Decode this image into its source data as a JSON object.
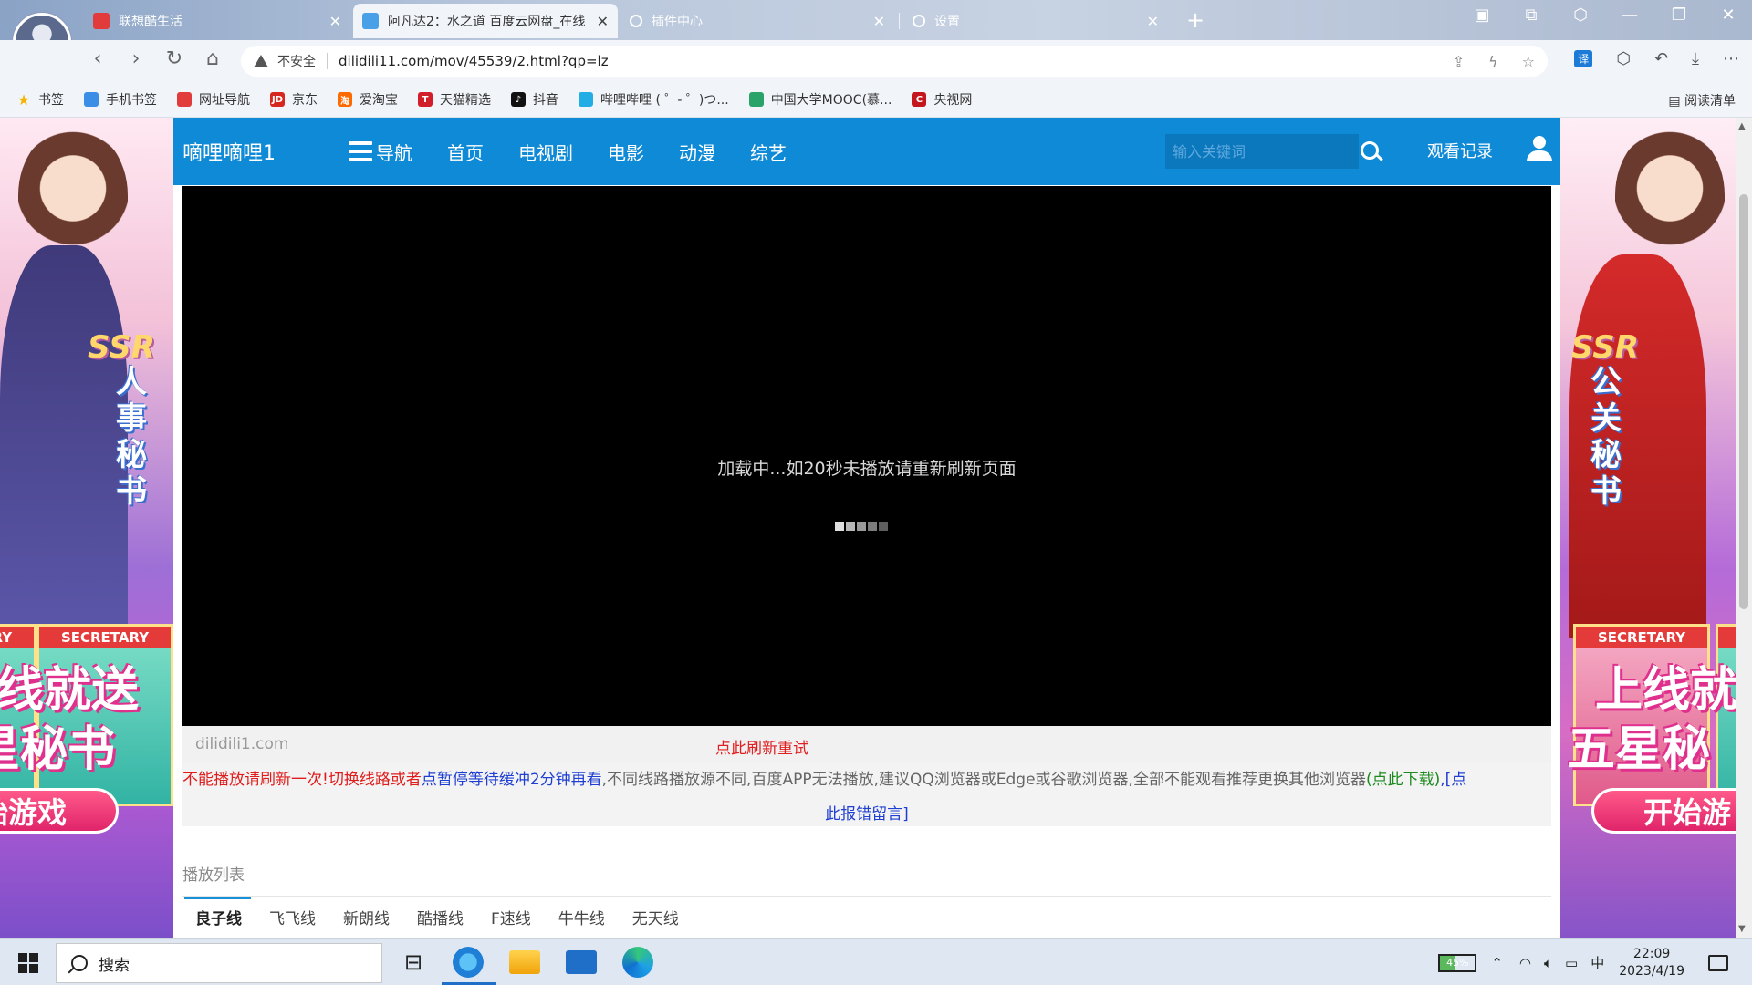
{
  "browser": {
    "tabs": [
      {
        "title": "联想酷生活",
        "favicon_color": "#e23b3b",
        "active": false
      },
      {
        "title": "阿凡达2：水之道 百度云网盘_在线",
        "favicon_color": "#4aa0e6",
        "active": true
      },
      {
        "title": "插件中心",
        "favicon_color": "#888888",
        "active": false
      },
      {
        "title": "设置",
        "favicon_color": "#888888",
        "active": false
      }
    ],
    "new_tab_label": "+",
    "insecure_label": "不安全",
    "url": "dilidili11.com/mov/45539/2.html?qp=lz",
    "translate_badge": "译",
    "bookmarks": [
      {
        "label": "书签",
        "color": "#f5b400",
        "glyph": "★"
      },
      {
        "label": "手机书签",
        "color": "#3a8ee6",
        "glyph": ""
      },
      {
        "label": "网址导航",
        "color": "#e23b3b",
        "glyph": ""
      },
      {
        "label": "京东",
        "color": "#d7261e",
        "glyph": "JD"
      },
      {
        "label": "爱淘宝",
        "color": "#ff6a00",
        "glyph": "淘"
      },
      {
        "label": "天猫精选",
        "color": "#d21e2b",
        "glyph": "T"
      },
      {
        "label": "抖音",
        "color": "#111111",
        "glyph": "♪"
      },
      {
        "label": "哔哩哔哩 ( ゜- ゜)つ...",
        "color": "#23ade5",
        "glyph": ""
      },
      {
        "label": "中国大学MOOC(慕...",
        "color": "#2aa36b",
        "glyph": ""
      },
      {
        "label": "央视网",
        "color": "#c4161c",
        "glyph": "C"
      }
    ],
    "reading_list": "阅读清单"
  },
  "site": {
    "logo": "嘀哩嘀哩1",
    "nav": [
      "导航",
      "首页",
      "电视剧",
      "电影",
      "动漫",
      "综艺"
    ],
    "search_placeholder": "输入关键词",
    "history": "观看记录"
  },
  "player": {
    "loading_text": "加载中...如20秒未播放请重新刷新页面",
    "dot_colors": [
      "#e0e0e0",
      "#b8b8b8",
      "#9a9a9a",
      "#7c7c7c",
      "#5e5e5e"
    ],
    "domain": "dilidili1.com",
    "refresh": "点此刷新重试"
  },
  "notice": {
    "part1": "不能播放请刷新一次!切换线路或者",
    "part2": "点暂停等待缓冲2分钟再看",
    "part3": ",不同线路播放源不同,百度APP无法播放,建议QQ浏览器或Edge或谷歌浏览器,全部不能观看推荐更换其他浏览器",
    "part4": "(点此下载)",
    "part5a": ",[点",
    "part5b": "此报错留言]"
  },
  "playlist": {
    "label": "播放列表",
    "routes": [
      "良子线",
      "飞飞线",
      "新朗线",
      "酷播线",
      "F速线",
      "牛牛线",
      "无天线"
    ],
    "active_index": 0
  },
  "ads": {
    "left": {
      "ssr": "SSR",
      "title": "人事秘书",
      "card_head": "SECRETARY",
      "big1": "线就送",
      "big2": "星秘书",
      "button": "始游戏"
    },
    "right": {
      "ssr": "SSR",
      "title": "公关秘书",
      "card_head": "SECRETARY",
      "big1": "上线就",
      "big2": "五星秘",
      "button": "开始游"
    }
  },
  "taskbar": {
    "search": "搜索",
    "battery": "45%",
    "ime": "中",
    "time": "22:09",
    "date": "2023/4/19"
  }
}
